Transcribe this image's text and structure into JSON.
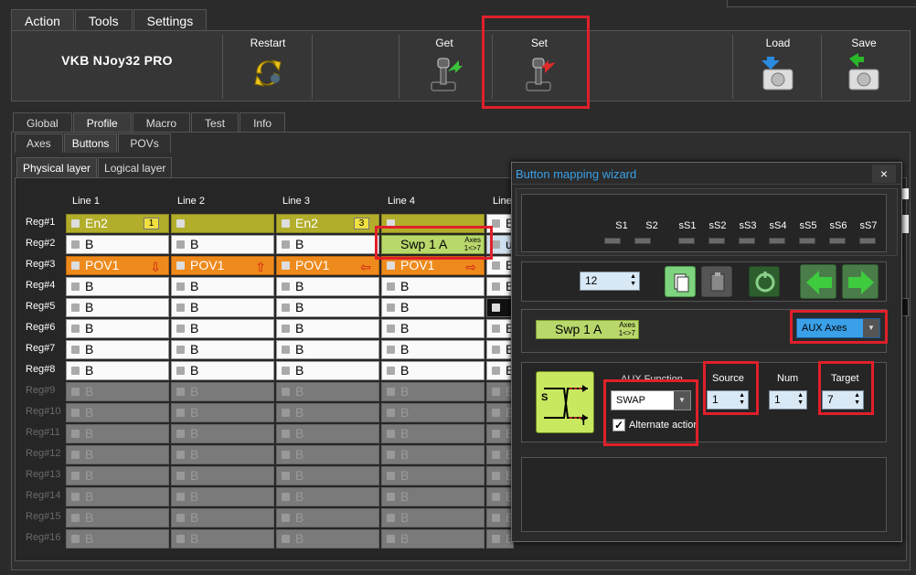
{
  "top_tabs": [
    "Action",
    "Tools",
    "Settings"
  ],
  "toolbar": {
    "device_name": "VKB NJoy32 PRO",
    "restart": "Restart",
    "get": "Get",
    "set": "Set",
    "load": "Load",
    "save": "Save"
  },
  "main_tabs": [
    "Global",
    "Profile",
    "Macro",
    "Test",
    "Info"
  ],
  "sub_tabs": [
    "Axes",
    "Buttons",
    "POVs"
  ],
  "layer_tabs": [
    "Physical layer",
    "Logical layer"
  ],
  "grid": {
    "columns": [
      "Line 1",
      "Line 2",
      "Line 3",
      "Line 4",
      "Line"
    ],
    "rows": [
      "Reg#1",
      "Reg#2",
      "Reg#3",
      "Reg#4",
      "Reg#5",
      "Reg#6",
      "Reg#7",
      "Reg#8",
      "Reg#9",
      "Reg#10",
      "Reg#11",
      "Reg#12",
      "Reg#13",
      "Reg#14",
      "Reg#15",
      "Reg#16"
    ],
    "en2": "En2",
    "en2_badge_1": "1",
    "en2_badge_3": "3",
    "b": "B",
    "pov1": "POV1",
    "swp": "Swp 1 A",
    "swp_mini_top": "Axes",
    "swp_mini_bottom": "1<>7",
    "col5_r1": "B",
    "col5_r2": "u",
    "colors": {
      "olive": "#b2ad2a",
      "orange": "#ee8a1c",
      "green": "#b9d86c"
    }
  },
  "wizard": {
    "title": "Button mapping wizard",
    "close": "×",
    "shift_labels": [
      "S1",
      "S2",
      "sS1",
      "sS2",
      "sS3",
      "sS4",
      "sS5",
      "sS6",
      "sS7"
    ],
    "button_number": "12",
    "swp_label": "Swp 1 A",
    "swp_mini_top": "Axes",
    "swp_mini_bottom": "1<>7",
    "type_select": "AUX Axes",
    "aux_function_label": "AUX Function",
    "aux_function_value": "SWAP",
    "alternate_action": "Alternate action",
    "source_label": "Source",
    "source_value": "1",
    "num_label": "Num",
    "num_value": "1",
    "target_label": "Target",
    "target_value": "7",
    "swap_icon_s": "S",
    "swap_icon_t": "T"
  }
}
